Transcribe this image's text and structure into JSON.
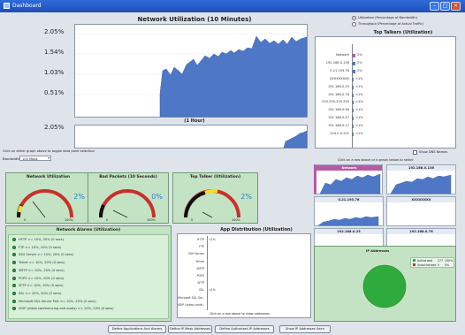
{
  "window": {
    "title": "Dashboard"
  },
  "util_chart": {
    "title": "Network Utilization (10 Minutes)",
    "y_ticks": [
      "2.05%",
      "1.54%",
      "1.03%",
      "0.51%"
    ]
  },
  "hour_chart": {
    "title": "(1 Hour)",
    "y_tick": "2.05%"
  },
  "graph_hint": "Click on either graph above to toggle data point selection",
  "bandwidth": {
    "label": "Bandwidth:",
    "value": "100 Mbps"
  },
  "options": {
    "utilization": "Utilization (Percentage of Bandwidth)",
    "throughput": "Throughput (Percentage of Actual Traffic)"
  },
  "top_talkers": {
    "title": "Top Talkers (Utilization)",
    "rows": [
      {
        "name": "Network",
        "val": "2%"
      },
      {
        "name": "192.168.0.136",
        "val": "2%"
      },
      {
        "name": "0.21.193.76",
        "val": "2%"
      },
      {
        "name": "XXXXXXXXX",
        "val": "<1%"
      },
      {
        "name": "192.168.0.25",
        "val": "<1%"
      },
      {
        "name": "192.168.0.76",
        "val": "<1%"
      },
      {
        "name": "255.255.255.255",
        "val": "<1%"
      },
      {
        "name": "192.168.0.46",
        "val": "<1%"
      },
      {
        "name": "192.168.0.47",
        "val": "<1%"
      },
      {
        "name": "192.168.0.17",
        "val": "<1%"
      },
      {
        "name": "224.0.0.251",
        "val": "<1%"
      }
    ],
    "show_dns": "Show DNS Names",
    "select_hint": "Click on a row above or a graph below to select"
  },
  "thumbs": [
    {
      "label": "Network"
    },
    {
      "label": "192.168.0.136"
    },
    {
      "label": "0.21.193.76"
    },
    {
      "label": "XXXXXXXX"
    },
    {
      "label": "192.168.0.25"
    },
    {
      "label": "192.168.0.76"
    }
  ],
  "gauges": [
    {
      "title": "Network Utilization",
      "value": "2%",
      "min": "0",
      "max": "100%"
    },
    {
      "title": "Bad Packets (10 Seconds)",
      "value": "0%",
      "min": "0",
      "max": "100%"
    },
    {
      "title": "Top Talker (Utilization)",
      "value": "2%",
      "min": "0",
      "max": "100%"
    }
  ],
  "alarms": {
    "title": "Network Alarms (Utilization)",
    "items": [
      "HTTP >= 10%, 20% (0 secs)",
      "FTP >= 10%, 20% (0 secs)",
      "SSH Server >= 10%, 20% (0 secs)",
      "Telnet >= 10%, 20% (0 secs)",
      "SMTP >= 10%, 20% (0 secs)",
      "POP3 >= 10%, 20% (0 secs)",
      "SFTP >= 10%, 20% (0 secs)",
      "SSL >= 10%, 20% (0 secs)",
      "Microsoft SQL Server Port >= 10%, 20% (0 secs)",
      "VOIP (video conferencing and audio) >= 10%, 20% (0 secs)"
    ]
  },
  "app_dist": {
    "title": "App Distribution (Utilization)",
    "rows": [
      {
        "name": "HTTP",
        "val": "<1%"
      },
      {
        "name": "FTP",
        "val": ""
      },
      {
        "name": "SSH Server",
        "val": ""
      },
      {
        "name": "Telnet",
        "val": ""
      },
      {
        "name": "SMTP",
        "val": ""
      },
      {
        "name": "POP3",
        "val": ""
      },
      {
        "name": "SFTP",
        "val": ""
      },
      {
        "name": "SSL",
        "val": "<1%"
      },
      {
        "name": "Microsoft SQL Ser..",
        "val": ""
      },
      {
        "name": "VOIP (video confe..",
        "val": ""
      }
    ],
    "hint": "Click on a row above to show addresses"
  },
  "ip_panel": {
    "title": "IP Addresses",
    "legend": [
      {
        "label": "Authorized",
        "count": "277",
        "pct": "100%",
        "color": "#2faa3c"
      },
      {
        "label": "Unauthorized",
        "count": "0",
        "pct": "0%",
        "color": "#c0392b"
      }
    ]
  },
  "buttons": {
    "define_apps": "Define Applications And Alarms",
    "define_ip": "Define IP Mask Addresses",
    "define_auth": "Define Authorized IP Addresses",
    "show_ip": "Show IP Addresses Seen"
  }
}
